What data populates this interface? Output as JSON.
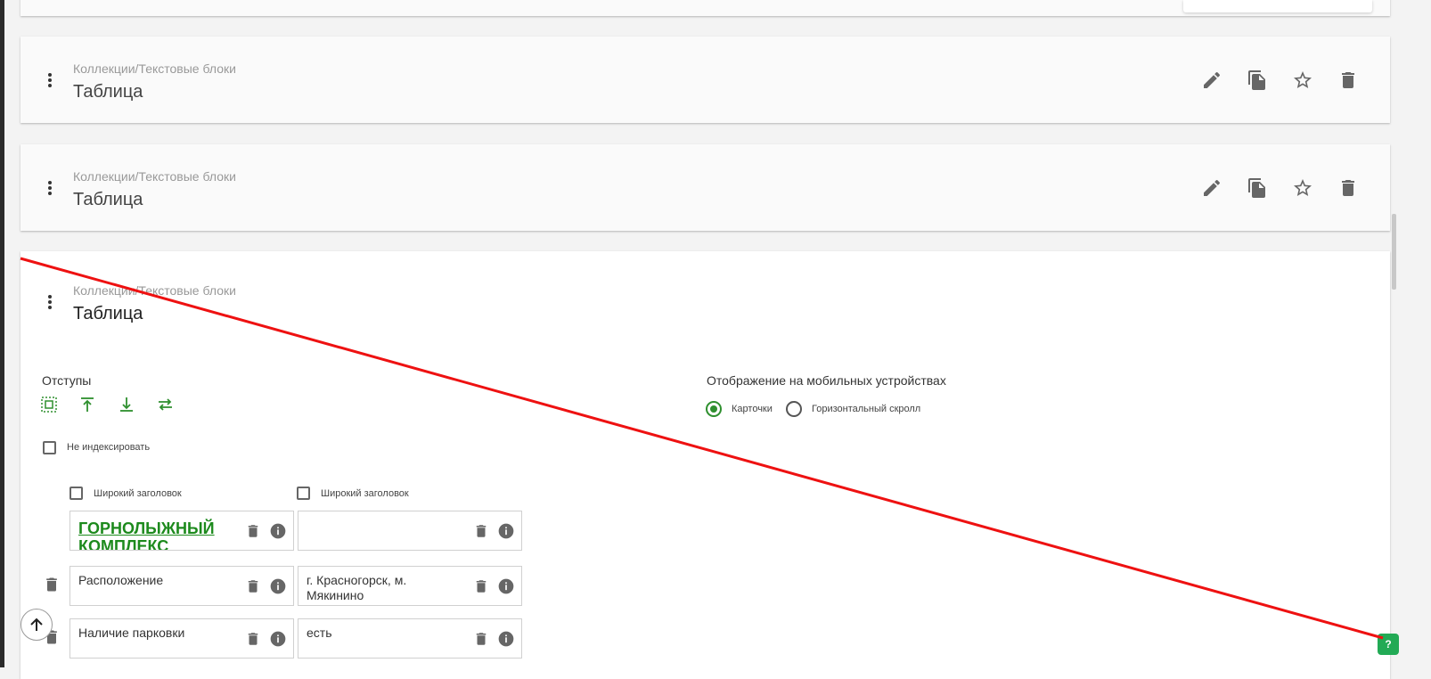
{
  "cards": [
    {
      "breadcrumb": "Коллекции/Текстовые блоки",
      "title": "Таблица"
    },
    {
      "breadcrumb": "Коллекции/Текстовые блоки",
      "title": "Таблица"
    },
    {
      "breadcrumb": "Коллекции/Текстовые блоки",
      "title": "Таблица"
    }
  ],
  "actions": [
    "edit-icon",
    "copy-icon",
    "star-icon",
    "trash-icon"
  ],
  "editor": {
    "margins_label": "Отступы",
    "no_index_label": "Не индексировать",
    "mobile_label": "Отображение на мобильных устройствах",
    "mobile_options": [
      {
        "label": "Карточки",
        "selected": true
      },
      {
        "label": "Горизонтальный скролл",
        "selected": false
      }
    ],
    "wide_header_label_1": "Широкий заголовок",
    "wide_header_label_2": "Широкий заголовок",
    "table": {
      "header": [
        "ГОРНОЛЫЖНЫЙ КОМПЛЕКС",
        ""
      ],
      "rows": [
        [
          "Расположение",
          "г. Красногорск, м. Мякинино"
        ],
        [
          "Наличие парковки",
          "есть"
        ]
      ]
    }
  },
  "colors": {
    "accent": "#2e8f2e",
    "annotation": "#ee1111"
  }
}
